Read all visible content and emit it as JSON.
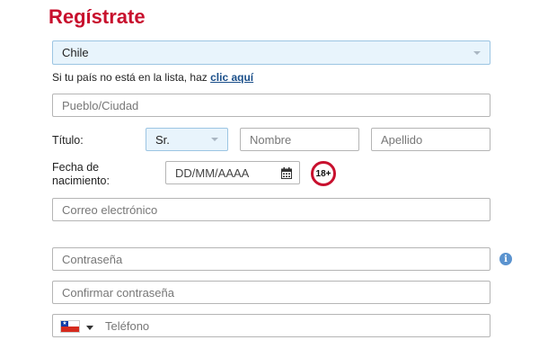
{
  "form": {
    "title": "Regístrate",
    "country": {
      "value": "Chile"
    },
    "country_note": {
      "text": "Si tu país no está en la lista, haz ",
      "link": "clic aquí"
    },
    "town": {
      "placeholder": "Pueblo/Ciudad"
    },
    "title_label": "Título:",
    "salutation": {
      "value": "Sr."
    },
    "first_name": {
      "placeholder": "Nombre"
    },
    "last_name": {
      "placeholder": "Apellido"
    },
    "dob_label_line1": "Fecha de",
    "dob_label_line2": "nacimiento:",
    "dob": {
      "placeholder": "DD/MM/AAAA"
    },
    "age_badge": "18+",
    "email": {
      "placeholder": "Correo electrónico"
    },
    "password": {
      "placeholder": "Contraseña"
    },
    "confirm_password": {
      "placeholder": "Confirmar contraseña"
    },
    "phone": {
      "placeholder": "Teléfono",
      "flag": "chile-flag"
    },
    "info_icon_glyph": "i"
  },
  "colors": {
    "brand_red": "#c8102e",
    "link_blue": "#1a4f8a",
    "select_bg": "#e8f4fc",
    "info_blue": "#5b93cf"
  }
}
